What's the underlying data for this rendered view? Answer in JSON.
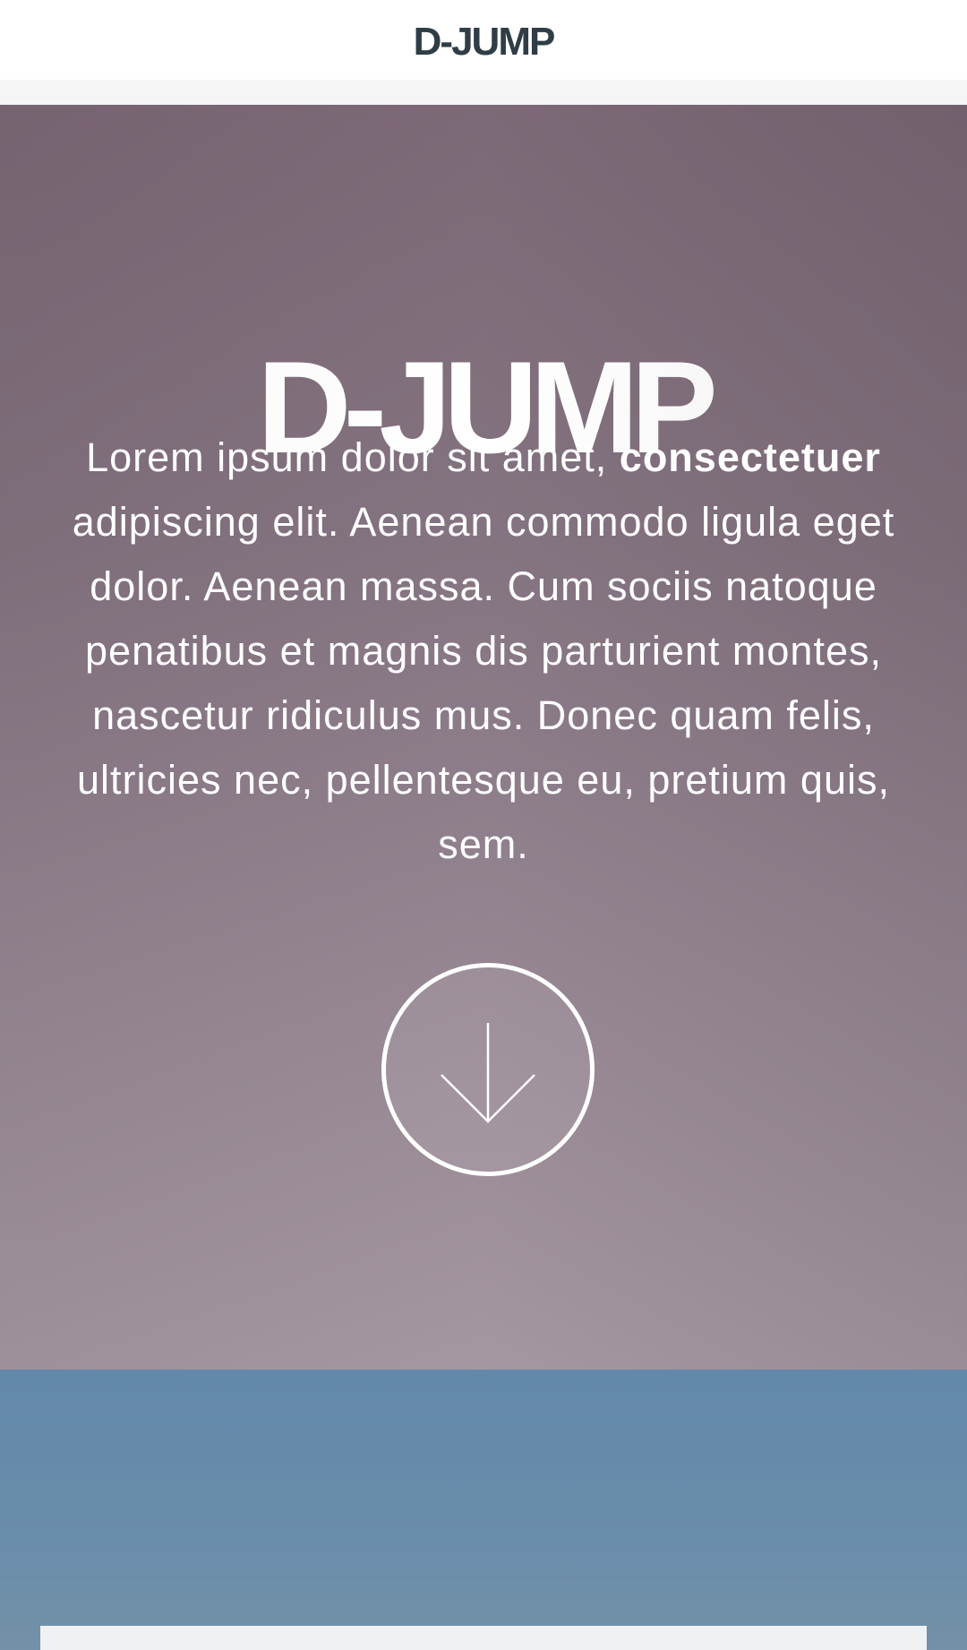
{
  "header": {
    "brand": "D-JUMP"
  },
  "hero": {
    "title": "D-JUMP",
    "text_bold": "consectetuer",
    "text_before": "Lorem ipsum dolor sit amet, ",
    "text_after": " adipiscing elit. Aenean commodo ligula eget dolor. Aenean massa. Cum sociis natoque penatibus et magnis dis parturient montes, nascetur ridiculus mus. Donec quam felis, ultricies nec, pellentesque eu, pretium quis, sem.",
    "scroll_icon": "arrow-down-circle-icon"
  },
  "colors": {
    "header_text": "#2f3d46",
    "hero_top": "#7a6674",
    "hero_bottom": "#a3959f",
    "blue_section": "#6288ab",
    "card": "#f0f1f3"
  }
}
